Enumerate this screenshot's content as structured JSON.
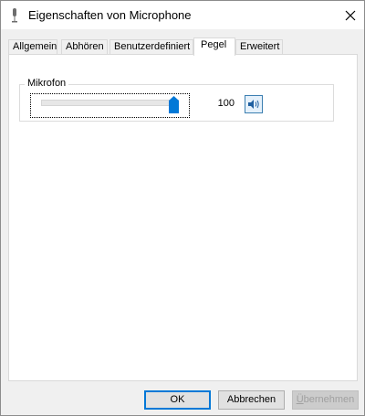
{
  "window": {
    "title": "Eigenschaften von Microphone"
  },
  "tabs": [
    {
      "label": "Allgemein",
      "active": false
    },
    {
      "label": "Abhören",
      "active": false
    },
    {
      "label": "Benutzerdefiniert",
      "active": false
    },
    {
      "label": "Pegel",
      "active": true
    },
    {
      "label": "Erweitert",
      "active": false
    }
  ],
  "levels": {
    "group_label": "Mikrofon",
    "value": "100",
    "slider_level_percent": 100
  },
  "buttons": {
    "ok": "OK",
    "cancel": "Abbrechen",
    "apply_first": "Ü",
    "apply_rest": "bernehmen"
  },
  "colors": {
    "accent": "#0078d7",
    "thumb": "#0078d7"
  },
  "icons": {
    "title": "microphone-icon",
    "close": "close-icon",
    "mute": "speaker-icon"
  }
}
